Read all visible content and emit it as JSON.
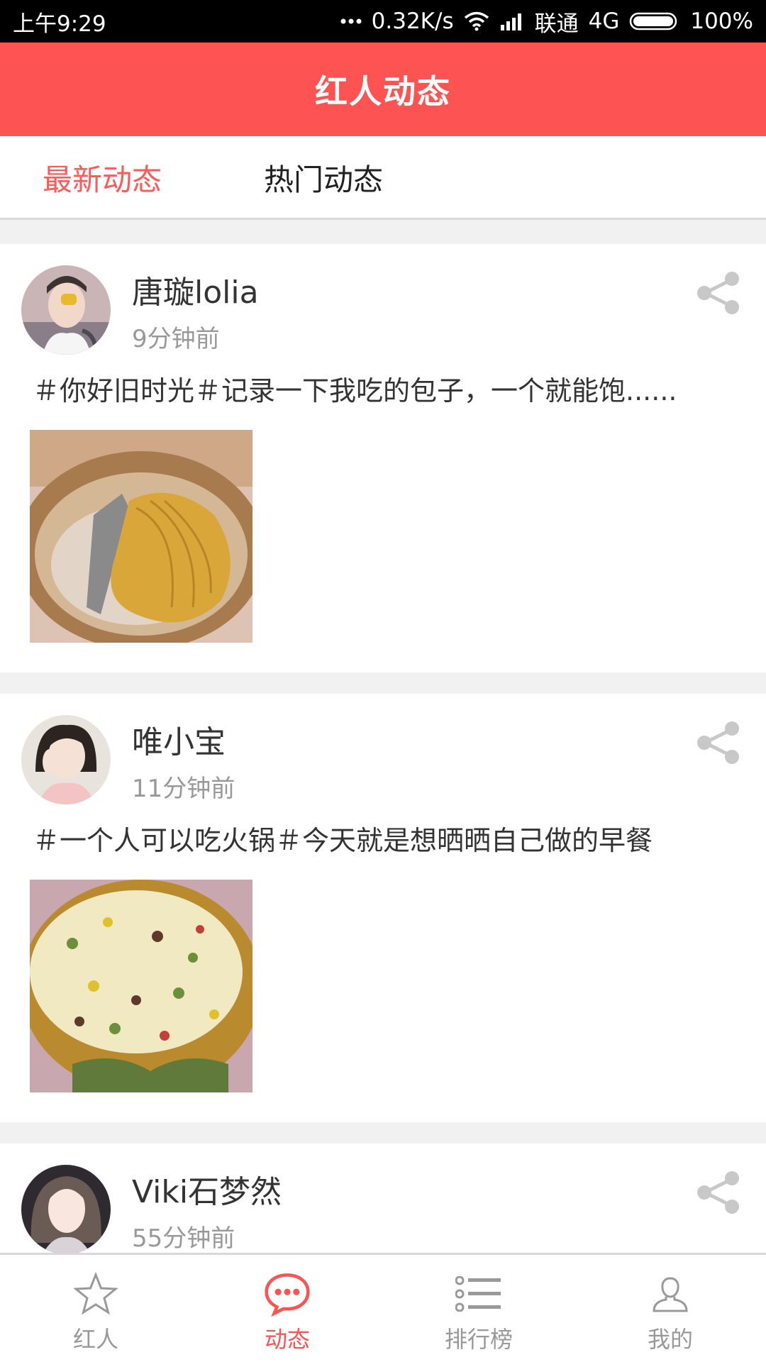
{
  "status_bar": {
    "time": "上午9:29",
    "speed": "0.32K/s",
    "carrier": "联通",
    "network": "4G",
    "battery": "100%"
  },
  "header": {
    "title": "红人动态"
  },
  "tabs": [
    {
      "label": "最新动态",
      "active": true
    },
    {
      "label": "热门动态",
      "active": false
    }
  ],
  "posts": [
    {
      "username": "唐璇lolia",
      "time": "9分钟前",
      "text": "＃你好旧时光＃记录一下我吃的包子，一个就能饱......"
    },
    {
      "username": "唯小宝",
      "time": "11分钟前",
      "text": "＃一个人可以吃火锅＃今天就是想晒晒自己做的早餐"
    },
    {
      "username": "Viki石梦然",
      "time": "55分钟前"
    }
  ],
  "bottom_nav": [
    {
      "label": "红人",
      "icon": "star-icon",
      "active": false
    },
    {
      "label": "动态",
      "icon": "chat-bubble-icon",
      "active": true
    },
    {
      "label": "排行榜",
      "icon": "list-icon",
      "active": false
    },
    {
      "label": "我的",
      "icon": "person-icon",
      "active": false
    }
  ],
  "colors": {
    "accent": "#fe5353",
    "inactive": "#999999",
    "divider": "#f1f1f1"
  }
}
